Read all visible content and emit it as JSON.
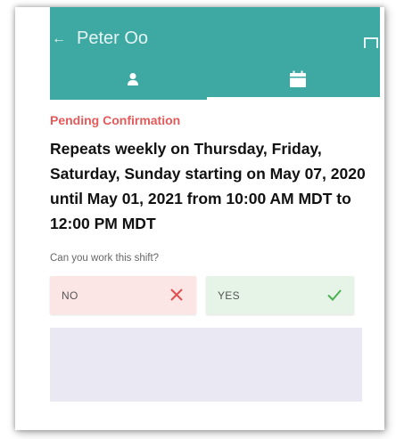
{
  "header": {
    "title": "Peter Oo",
    "back_icon": "back-arrow-icon",
    "menu_icon": "menu-icon",
    "color": "#3ea9a3"
  },
  "tabs": [
    {
      "icon": "person-icon",
      "selected": false
    },
    {
      "icon": "calendar-icon",
      "selected": true
    }
  ],
  "shift": {
    "status": "Pending Confirmation",
    "status_color": "#e45a5a",
    "description": "Repeats weekly on Thursday, Friday, Saturday, Sunday starting on May 07, 2020 until May 01, 2021 from 10:00 AM MDT to 12:00 PM MDT"
  },
  "question": "Can you work this shift?",
  "answers": {
    "no": {
      "label": "NO",
      "icon": "x-icon",
      "color": "#e05050"
    },
    "yes": {
      "label": "YES",
      "icon": "check-icon",
      "color": "#4caf50"
    }
  }
}
